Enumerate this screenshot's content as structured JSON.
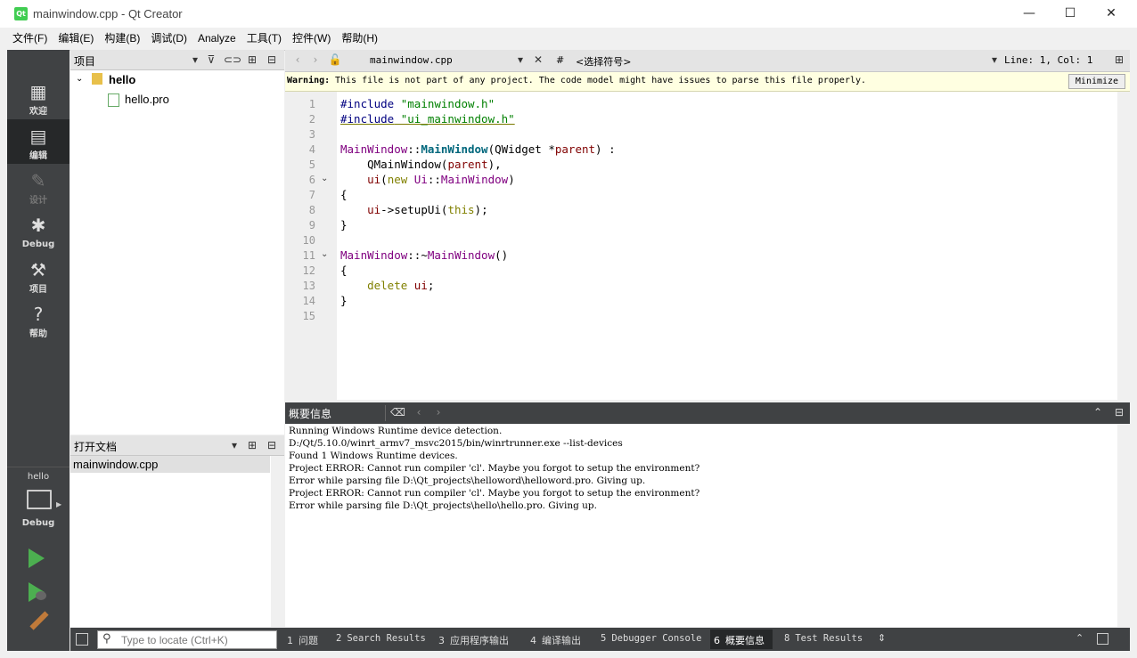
{
  "window": {
    "title": "mainwindow.cpp - Qt Creator",
    "app_icon_text": "Qt",
    "minimize_glyph": "—",
    "maximize_glyph": "☐",
    "close_glyph": "✕"
  },
  "menu": [
    "文件(F)",
    "编辑(E)",
    "构建(B)",
    "调试(D)",
    "Analyze",
    "工具(T)",
    "控件(W)",
    "帮助(H)"
  ],
  "modes": [
    {
      "label": "欢迎",
      "icon": "welcome-grid-icon"
    },
    {
      "label": "编辑",
      "icon": "edit-document-icon"
    },
    {
      "label": "设计",
      "icon": "design-pencil-icon"
    },
    {
      "label": "Debug",
      "icon": "debug-bug-icon"
    },
    {
      "label": "项目",
      "icon": "projects-wrench-icon"
    },
    {
      "label": "帮助",
      "icon": "help-question-icon"
    }
  ],
  "kit": {
    "project": "hello",
    "config": "Debug"
  },
  "project_panel": {
    "title": "项目",
    "root": "hello",
    "file": "hello.pro"
  },
  "open_docs": {
    "title": "打开文档",
    "items": [
      "mainwindow.cpp"
    ]
  },
  "editor": {
    "file": "mainwindow.cpp",
    "symbol": "<选择符号>",
    "hash": "#",
    "position": "Line: 1, Col: 1",
    "warning_label": "Warning:",
    "warning_text": " This file is not part of any project. The code model might have issues to parse this file properly.",
    "minimize_label": "Minimize",
    "line_numbers": [
      "1",
      "2",
      "3",
      "4",
      "5",
      "6",
      "7",
      "8",
      "9",
      "10",
      "11",
      "12",
      "13",
      "14",
      "15"
    ],
    "fold_lines": [
      "6",
      "11"
    ]
  },
  "code": {
    "l1_pp": "#include",
    "l1_str": " \"mainwindow.h\"",
    "l2_pp": "#include",
    "l2_str": " \"ui_mainwindow.h\"",
    "l4_cls": "MainWindow",
    "l4_sep": "::",
    "l4_fn": "MainWindow",
    "l4_open": "(",
    "l4_type": "QWidget",
    "l4_star": " *",
    "l4_param": "parent",
    "l4_close": ") :",
    "l5_indent": "    ",
    "l5_fn": "QMainWindow",
    "l5_open": "(",
    "l5_param": "parent",
    "l5_close": "),",
    "l6_indent": "    ",
    "l6_var": "ui",
    "l6_open": "(",
    "l6_kw": "new",
    "l6_ns": " Ui",
    "l6_sep": "::",
    "l6_cls": "MainWindow",
    "l6_close": ")",
    "l7": "{",
    "l8_indent": "    ",
    "l8_var": "ui",
    "l8_arrow": "->setupUi(",
    "l8_kw": "this",
    "l8_close": ");",
    "l9": "}",
    "l11_cls": "MainWindow",
    "l11_sep": "::~",
    "l11_fn": "MainWindow",
    "l11_close": "()",
    "l12": "{",
    "l13_indent": "    ",
    "l13_kw": "delete",
    "l13_var": " ui",
    "l13_close": ";",
    "l14": "}"
  },
  "output": {
    "title": "概要信息",
    "lines": [
      "Running Windows Runtime device detection.",
      "D:/Qt/5.10.0/winrt_armv7_msvc2015/bin/winrtrunner.exe --list-devices",
      "Found 1 Windows Runtime devices.",
      "Project ERROR: Cannot run compiler 'cl'. Maybe you forgot to setup the environment?",
      "Error while parsing file D:\\Qt_projects\\helloword\\helloword.pro. Giving up.",
      "Project ERROR: Cannot run compiler 'cl'. Maybe you forgot to setup the environment?",
      "Error while parsing file D:\\Qt_projects\\hello\\hello.pro. Giving up."
    ]
  },
  "statusbar": {
    "locate_placeholder": "Type to locate (Ctrl+K)",
    "tabs": [
      {
        "num": "1",
        "label": "问题"
      },
      {
        "num": "2",
        "label": "Search Results"
      },
      {
        "num": "3",
        "label": "应用程序输出"
      },
      {
        "num": "4",
        "label": "编译输出"
      },
      {
        "num": "5",
        "label": "Debugger Console"
      },
      {
        "num": "6",
        "label": "概要信息"
      },
      {
        "num": "8",
        "label": "Test Results"
      }
    ]
  },
  "colors": {
    "accent_run": "#4caf50",
    "modebar": "#404244",
    "warning_bg": "#ffffe1"
  }
}
